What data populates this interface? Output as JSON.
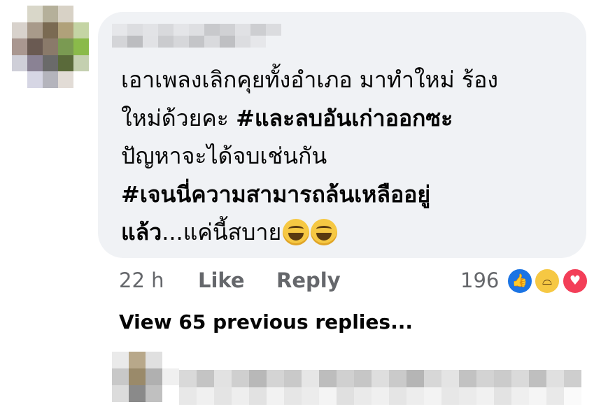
{
  "comment": {
    "lines": [
      {
        "plain": "เอาเพลงเลิกคุยทั้งอำเภอ มาทำใหม่ ร้อง"
      },
      {
        "plain": "ใหม่ด้วยคะ ",
        "bold": "#และลบอันเก่าออกซะ"
      },
      {
        "plain": "ปัญหาจะได้จบเช่นกัน"
      },
      {
        "bold": "#เจนนี่ความสามารถล้นเหลืออยู่"
      },
      {
        "bold": "แล้ว",
        "plain": "...แค่นี้สบาย"
      }
    ],
    "emoji_names": [
      "laughing-emoji",
      "laughing-emoji"
    ]
  },
  "actions": {
    "time": "22 h",
    "like": "Like",
    "reply": "Reply"
  },
  "reactions": {
    "count": "196",
    "icons": [
      "like-icon",
      "haha-icon",
      "love-icon"
    ]
  },
  "view_replies": "View 65 previous replies...",
  "colors": {
    "bubble": "#f0f2f5",
    "text": "#050505",
    "secondary_text": "#65676b",
    "like_blue": "#1b74e4",
    "haha_yellow": "#f6c843",
    "love_red": "#f33e58"
  }
}
